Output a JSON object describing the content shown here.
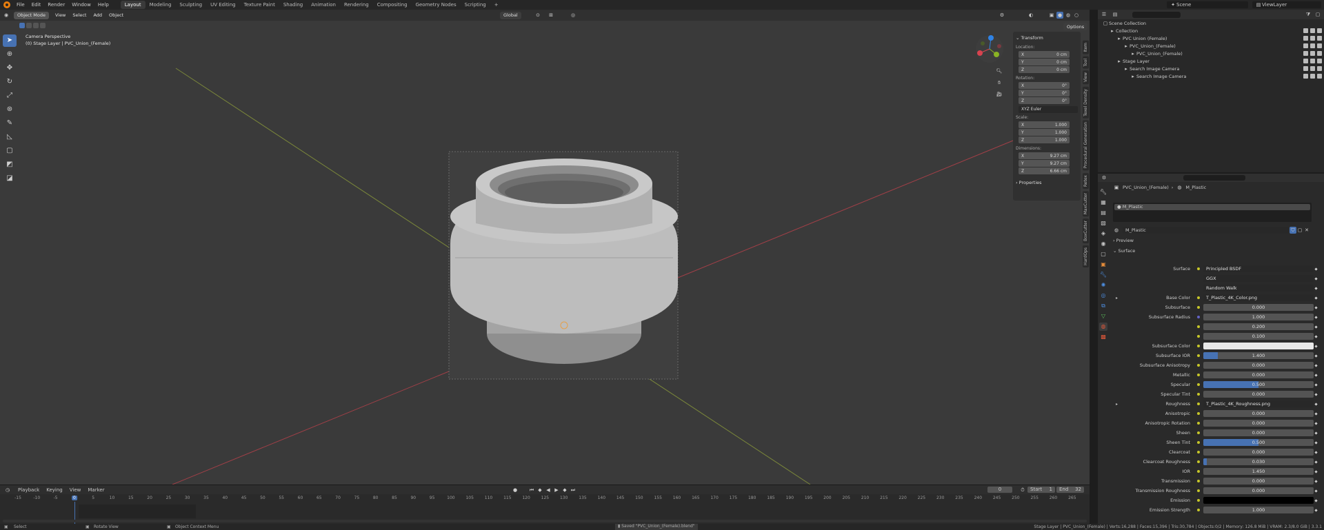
{
  "menu": {
    "items": [
      "File",
      "Edit",
      "Render",
      "Window",
      "Help"
    ],
    "workspaces": [
      "Layout",
      "Modeling",
      "Sculpting",
      "UV Editing",
      "Texture Paint",
      "Shading",
      "Animation",
      "Rendering",
      "Compositing",
      "Geometry Nodes",
      "Scripting"
    ],
    "active_workspace": "Layout",
    "add": "+",
    "scene": "Scene",
    "view_layer": "ViewLayer"
  },
  "viewport": {
    "mode": "Object Mode",
    "menus": [
      "View",
      "Select",
      "Add",
      "Object"
    ],
    "orientation": "Global",
    "options": "Options",
    "info_line1": "Camera Perspective",
    "info_line2": "(0) Stage Layer | PVC_Union_(Female)"
  },
  "npanel": {
    "transform": "Transform",
    "location": "Location:",
    "loc": [
      [
        "X",
        "0 cm"
      ],
      [
        "Y",
        "0 cm"
      ],
      [
        "Z",
        "0 cm"
      ]
    ],
    "rotation": "Rotation:",
    "rot": [
      [
        "X",
        "0°"
      ],
      [
        "Y",
        "0°"
      ],
      [
        "Z",
        "0°"
      ]
    ],
    "euler": "XYZ Euler",
    "scale": "Scale:",
    "scl": [
      [
        "X",
        "1.000"
      ],
      [
        "Y",
        "1.000"
      ],
      [
        "Z",
        "1.000"
      ]
    ],
    "dimensions": "Dimensions:",
    "dim": [
      [
        "X",
        "9.27 cm"
      ],
      [
        "Y",
        "9.27 cm"
      ],
      [
        "Z",
        "6.66 cm"
      ]
    ],
    "properties": "Properties",
    "tabs": [
      "Item",
      "Tool",
      "View",
      "Texel Density",
      "Procedural Generation",
      "Retex",
      "MaxCutter",
      "BoxCutter",
      "HardOps"
    ]
  },
  "timeline": {
    "menus": [
      "Playback",
      "Keying",
      "View",
      "Marker"
    ],
    "current_frame": "0",
    "start_label": "Start",
    "start": "1",
    "end_label": "End",
    "end": "32",
    "ticks": [
      "-15",
      "-10",
      "-5",
      "0",
      "5",
      "10",
      "15",
      "20",
      "25",
      "30",
      "35",
      "40",
      "45",
      "50",
      "55",
      "60",
      "65",
      "70",
      "75",
      "80",
      "85",
      "90",
      "95",
      "100",
      "105",
      "110",
      "115",
      "120",
      "125",
      "130",
      "135",
      "140",
      "145",
      "150",
      "155",
      "160",
      "165",
      "170",
      "175",
      "180",
      "185",
      "190",
      "195",
      "200",
      "205",
      "210",
      "215",
      "220",
      "225",
      "230",
      "235",
      "240",
      "245",
      "250",
      "255",
      "260",
      "265"
    ]
  },
  "status": {
    "select": "Select",
    "rotate": "Rotate View",
    "context": "Object Context Menu",
    "saved": "Saved \"PVC_Union_(Female).blend\"",
    "stats": "Stage Layer | PVC_Union_(Female) | Verts:16,288 | Faces:15,396 | Tris:30,784 | Objects:0/2 | Memory: 126.8 MiB | VRAM: 2.3/8.0 GiB | 3.3.1"
  },
  "outliner": {
    "root": "Scene Collection",
    "rows": [
      {
        "label": "Collection",
        "indent": 1
      },
      {
        "label": "PVC Union (Female)",
        "indent": 2
      },
      {
        "label": "PVC_Union_(Female)",
        "indent": 3
      },
      {
        "label": "PVC_Union_(Female)",
        "indent": 4
      },
      {
        "label": "Stage Layer",
        "indent": 2
      },
      {
        "label": "Search Image Camera",
        "indent": 3
      },
      {
        "label": "Search Image Camera",
        "indent": 4
      }
    ]
  },
  "properties": {
    "breadcrumb_obj": "PVC_Union_(Female)",
    "breadcrumb_mat": "M_Plastic",
    "slot": "M_Plastic",
    "material": "M_Plastic",
    "preview": "Preview",
    "surface_section": "Surface",
    "rows": [
      {
        "label": "Surface",
        "value": "Principled BSDF",
        "kind": "link"
      },
      {
        "label": "",
        "value": "GGX",
        "kind": "select"
      },
      {
        "label": "",
        "value": "Random Walk",
        "kind": "select"
      },
      {
        "label": "Base Color",
        "value": "T_Plastic_4K_Color.png",
        "kind": "link",
        "exp": true
      },
      {
        "label": "Subsurface",
        "value": "0.000",
        "fill": 0
      },
      {
        "label": "Subsurface Radius",
        "value": "1.000",
        "fill": 0,
        "dot": "blue"
      },
      {
        "label": "",
        "value": "0.200",
        "fill": 0
      },
      {
        "label": "",
        "value": "0.100",
        "fill": 0
      },
      {
        "label": "Subsurface Color",
        "value": "",
        "color": "#e8e8e8"
      },
      {
        "label": "Subsurface IOR",
        "value": "1.400",
        "fill": 0.13
      },
      {
        "label": "Subsurface Anisotropy",
        "value": "0.000",
        "fill": 0
      },
      {
        "label": "Metallic",
        "value": "0.000",
        "fill": 0
      },
      {
        "label": "Specular",
        "value": "0.500",
        "fill": 0.5
      },
      {
        "label": "Specular Tint",
        "value": "0.000",
        "fill": 0
      },
      {
        "label": "Roughness",
        "value": "T_Plastic_4K_Roughness.png",
        "kind": "link",
        "exp": true
      },
      {
        "label": "Anisotropic",
        "value": "0.000",
        "fill": 0
      },
      {
        "label": "Anisotropic Rotation",
        "value": "0.000",
        "fill": 0
      },
      {
        "label": "Sheen",
        "value": "0.000",
        "fill": 0
      },
      {
        "label": "Sheen Tint",
        "value": "0.500",
        "fill": 0.5
      },
      {
        "label": "Clearcoat",
        "value": "0.000",
        "fill": 0
      },
      {
        "label": "Clearcoat Roughness",
        "value": "0.030",
        "fill": 0.03
      },
      {
        "label": "IOR",
        "value": "1.450",
        "fill": 0
      },
      {
        "label": "Transmission",
        "value": "0.000",
        "fill": 0
      },
      {
        "label": "Transmission Roughness",
        "value": "0.000",
        "fill": 0
      },
      {
        "label": "Emission",
        "value": "",
        "color": "#000000"
      },
      {
        "label": "Emission Strength",
        "value": "1.000",
        "fill": 0
      }
    ]
  },
  "colors": {
    "accent": "#4772b3",
    "x_axis": "#b4414a",
    "y_axis": "#8a9a3a"
  }
}
